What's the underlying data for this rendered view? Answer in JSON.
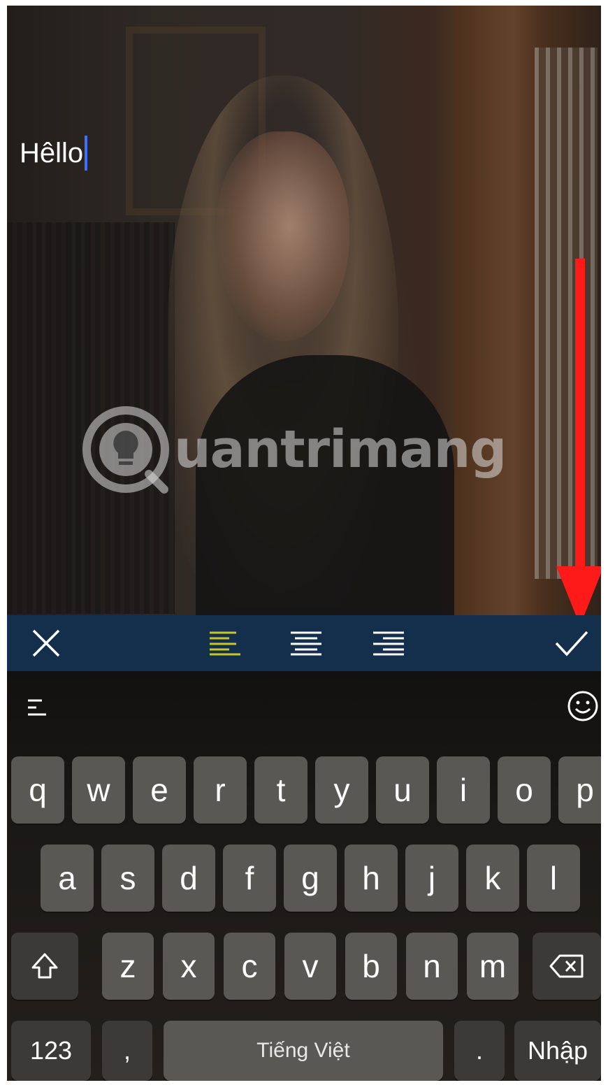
{
  "editor": {
    "typed_text": "Hêllo",
    "watermark_text": "uantrimang"
  },
  "toolbar": {
    "close_icon": "close-icon",
    "align_left_icon": "align-left-icon",
    "align_center_icon": "align-center-icon",
    "align_right_icon": "align-right-icon",
    "confirm_icon": "check-icon",
    "active_align_color": "#c9c42a",
    "background": "#142f4b"
  },
  "keyboard": {
    "row1": [
      "q",
      "w",
      "e",
      "r",
      "t",
      "y",
      "u",
      "i",
      "o",
      "p"
    ],
    "row2": [
      "a",
      "s",
      "d",
      "f",
      "g",
      "h",
      "j",
      "k",
      "l"
    ],
    "row3": [
      "z",
      "x",
      "c",
      "v",
      "b",
      "n",
      "m"
    ],
    "numbers_label": "123",
    "comma_label": ",",
    "space_label": "Tiếng Việt",
    "period_label": ".",
    "return_label": "Nhập"
  },
  "annotation": {
    "arrow_color": "#ff1a1a"
  }
}
